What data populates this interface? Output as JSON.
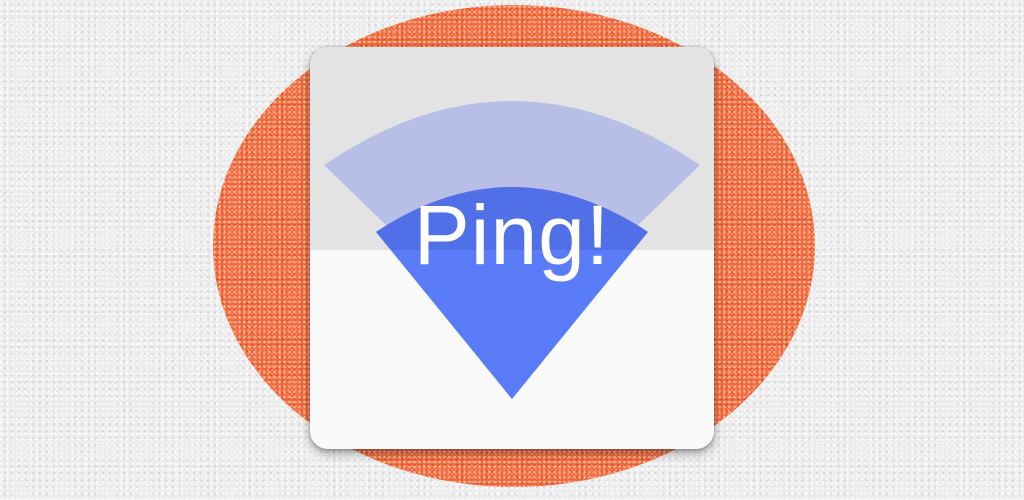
{
  "app_icon": {
    "title": "Ping!"
  },
  "colors": {
    "background": "#ececec",
    "blob": "#f26a3c",
    "tile_top": "#e3e3e3",
    "tile_bottom": "#fafafa",
    "outer_wave": "#b5bde6",
    "inner_wave": "#5a7cf8",
    "text": "#ffffff"
  },
  "icons": {
    "signal": "wifi-signal-icon"
  }
}
